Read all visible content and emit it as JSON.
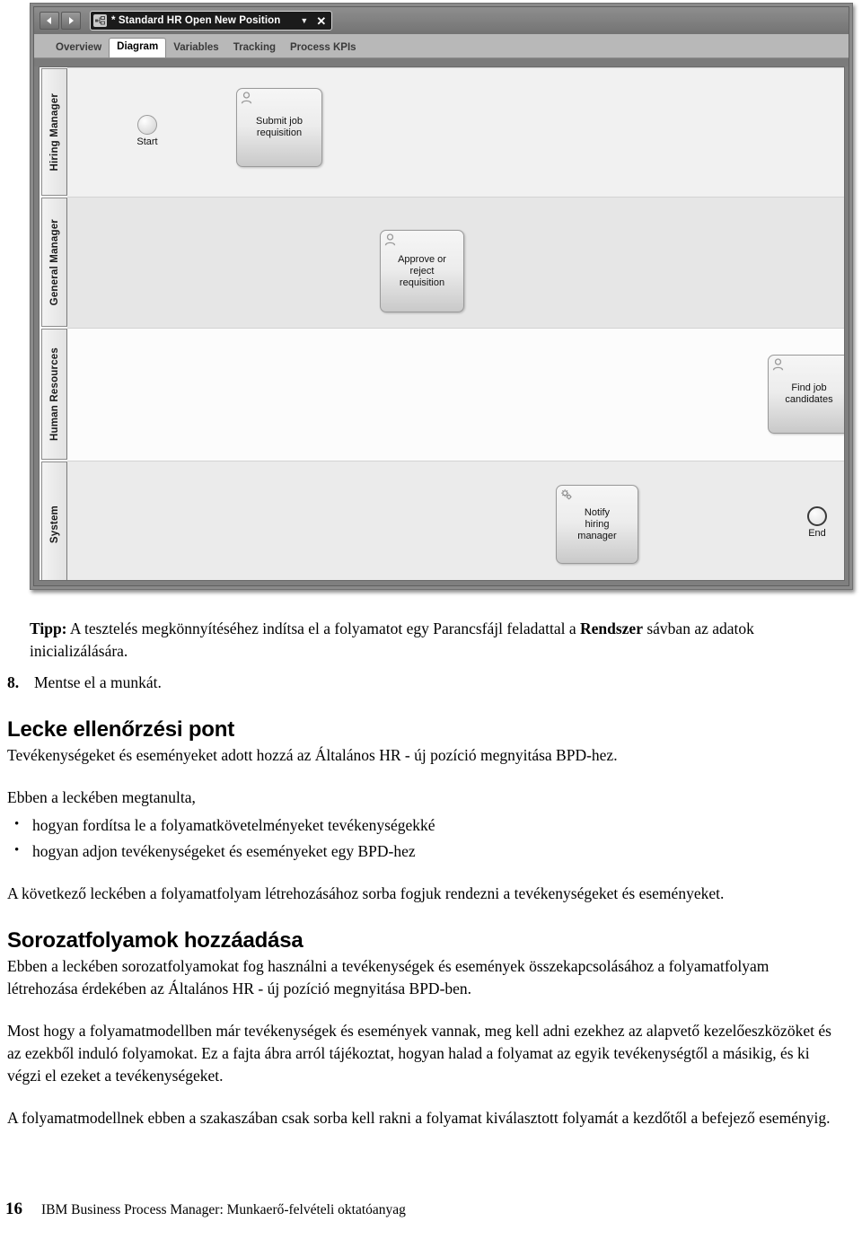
{
  "app": {
    "window_title": "* Standard HR Open New Position",
    "nav": {
      "back_label": "◀",
      "forward_label": "▶"
    },
    "chip": {
      "caret": "▼",
      "close": "✕"
    },
    "tabs": [
      {
        "label": "Overview",
        "active": false
      },
      {
        "label": "Diagram",
        "active": true
      },
      {
        "label": "Variables",
        "active": false
      },
      {
        "label": "Tracking",
        "active": false
      },
      {
        "label": "Process KPIs",
        "active": false
      }
    ]
  },
  "diagram": {
    "lanes": [
      {
        "name": "Hiring Manager"
      },
      {
        "name": "General Manager"
      },
      {
        "name": "Human Resources"
      },
      {
        "name": "System"
      }
    ],
    "nodes": [
      {
        "id": "start",
        "type": "start-event",
        "label": "Start",
        "lane": 0
      },
      {
        "id": "submit",
        "type": "user-task",
        "label": "Submit job\nrequisition",
        "lane": 0
      },
      {
        "id": "approve",
        "type": "user-task",
        "label": "Approve or\nreject\nrequisition",
        "lane": 1
      },
      {
        "id": "find",
        "type": "user-task",
        "label": "Find job\ncandidates",
        "lane": 2
      },
      {
        "id": "notify",
        "type": "system-task",
        "label": "Notify\nhiring\nmanager",
        "lane": 3
      },
      {
        "id": "end",
        "type": "end-event",
        "label": "End",
        "lane": 3
      }
    ]
  },
  "doc": {
    "tip_label": "Tipp:",
    "tip_pre": " A tesztelés megkönnyítéséhez indítsa el a folyamatot egy Parancsfájl feladattal a ",
    "tip_bold": "Rendszer",
    "tip_post": " sávban az adatok inicializálására.",
    "step_number": "8.",
    "step_text": "Mentse el a munkát.",
    "heading1": "Lecke ellenőrzési pont",
    "para1": "Tevékenységeket és eseményeket adott hozzá az Általános HR - új pozíció megnyitása BPD-hez.",
    "para2": "Ebben a leckében megtanulta,",
    "bullets": [
      "hogyan fordítsa le a folyamatkövetelményeket tevékenységekké",
      "hogyan adjon tevékenységeket és eseményeket egy BPD-hez"
    ],
    "para3": "A következő leckében a folyamatfolyam létrehozásához sorba fogjuk rendezni a tevékenységeket és eseményeket.",
    "heading2": "Sorozatfolyamok hozzáadása",
    "para4": "Ebben a leckében sorozatfolyamokat fog használni a tevékenységek és események összekapcsolásához a folyamatfolyam létrehozása érdekében az Általános HR - új pozíció megnyitása BPD-ben.",
    "para5": "Most hogy a folyamatmodellben már tevékenységek és események vannak, meg kell adni ezekhez az alapvető kezelőeszközöket és az ezekből induló folyamokat. Ez a fajta ábra arról tájékoztat, hogyan halad a folyamat az egyik tevékenységtől a másikig, és ki végzi el ezeket a tevékenységeket.",
    "para6": "A folyamatmodellnek ebben a szakaszában csak sorba kell rakni a folyamat kiválasztott folyamát a kezdőtől a befejező eseményig."
  },
  "footer": {
    "page_number": "16",
    "text": "IBM Business Process Manager:  Munkaerő-felvételi oktatóanyag"
  }
}
